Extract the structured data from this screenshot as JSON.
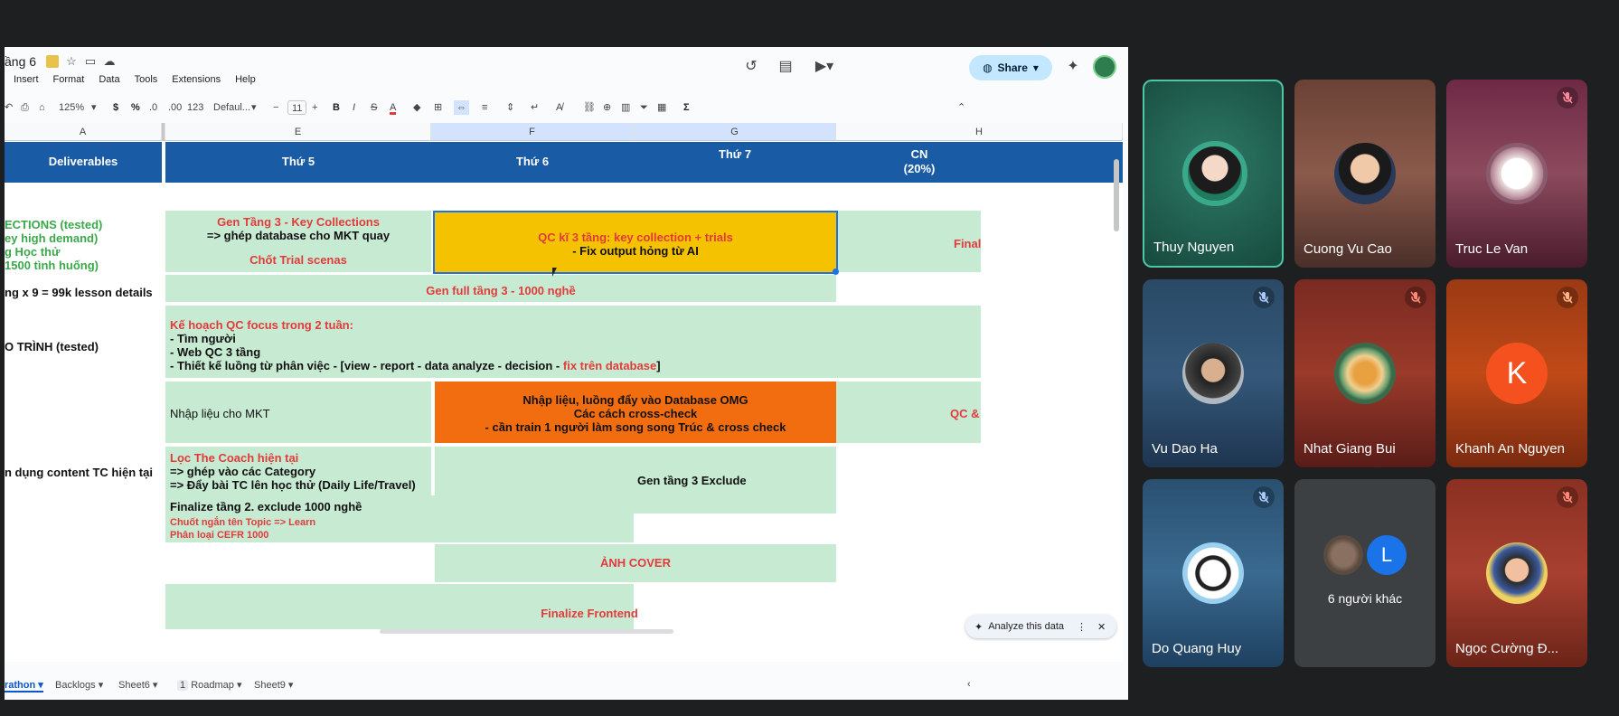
{
  "sheet": {
    "title": "ầng 6",
    "menu": [
      "Insert",
      "Format",
      "Data",
      "Tools",
      "Extensions",
      "Help"
    ],
    "share_label": "Share",
    "toolbar": {
      "zoom": "125%",
      "currency": "$",
      "percent": "%",
      "dec_minus": ".0",
      "dec_plus": ".00",
      "number_fmt": "123",
      "font": "Defaul...",
      "font_size": "11",
      "bold": "B",
      "italic": "I",
      "strike": "S",
      "text_color": "A",
      "functions": "Σ"
    },
    "columns": [
      "A",
      "E",
      "F",
      "G",
      "H"
    ],
    "headers": {
      "a": "Deliverables",
      "e": "Thứ 5",
      "f": "Thứ 6",
      "g": "Thứ 7",
      "h1": "CN",
      "h2": "(20%)"
    },
    "col_a": [
      "ECTIONS (tested)",
      "ey high demand)",
      "g Học thử",
      "1500 tình huống)",
      "ng x 9 = 99k lesson details",
      "O TRÌNH (tested)",
      "n dụng content TC hiện tại"
    ],
    "cells": {
      "gen_tang3": "Gen Tầng 3 - Key Collections",
      "ghep_db": "=> ghép database cho MKT quay",
      "chot_trial": "Chốt Trial scenas",
      "qc_title": "QC kĩ 3 tầng: key collection + trials",
      "qc_fix": "- Fix output hỏng từ AI",
      "final": "Final",
      "gen_full": "Gen full tầng 3 - 1000 nghề",
      "kehoach": "Kế hoạch QC focus trong 2 tuần:",
      "tim_nguoi": "- Tìm người",
      "web_qc": "- Web QC 3 tầng",
      "thiet_ke_a": "- Thiết kế luồng từ phân việc - [view - report - data analyze - decision - ",
      "thiet_ke_b": "fix trên database",
      "thiet_ke_c": "]",
      "nhap_lieu_mkt": "Nhập liệu cho MKT",
      "omg1": "Nhập liệu, luồng đẩy vào Database OMG",
      "omg2": "Các cách cross-check",
      "omg3": "- cần train 1 người làm song song Trúc & cross check",
      "qc_amp": "QC &",
      "loc_coach": "Lọc The Coach hiện tại",
      "ghep_cat": "=> ghép vào các Category",
      "day_bai": "=> Đẩy bài TC lên học thử (Daily Life/Travel)",
      "gen_exclude": "Gen tầng 3 Exclude",
      "finalize_t2": "Finalize tầng 2. exclude 1000 nghề",
      "chuot_ngan": "Chuốt ngắn tên Topic => Learn",
      "phan_loai": "Phân loại CEFR 1000",
      "anh_cover": "ẢNH COVER",
      "finalize_fe": "Finalize Frontend"
    },
    "tabs": [
      "rathon",
      "Backlogs",
      "Sheet6",
      "Roadmap",
      "Sheet9"
    ],
    "roadmap_badge": "1",
    "analyze_label": "Analyze this data"
  },
  "participants": [
    {
      "name": "Thuy Nguyen",
      "muted": false
    },
    {
      "name": "Cuong Vu Cao",
      "muted": false
    },
    {
      "name": "Truc Le Van",
      "muted": true
    },
    {
      "name": "Vu Dao Ha",
      "muted": true
    },
    {
      "name": "Nhat Giang Bui",
      "muted": true
    },
    {
      "name": "Khanh An Nguyen",
      "muted": true,
      "initial": "K"
    },
    {
      "name": "Do Quang Huy",
      "muted": true
    },
    {
      "name": "6 người khác",
      "muted": false,
      "initial": "L"
    },
    {
      "name": "Ngọc Cường Đ...",
      "muted": true
    }
  ],
  "colors": {
    "header_blue": "#1a5ba6",
    "cell_green": "#c7ead2",
    "highlight_yellow": "#f5c200",
    "highlight_orange": "#f26d0f",
    "text_red": "#e23b3b",
    "text_green": "#3aa84a",
    "active_speaker": "#50c6a5"
  }
}
